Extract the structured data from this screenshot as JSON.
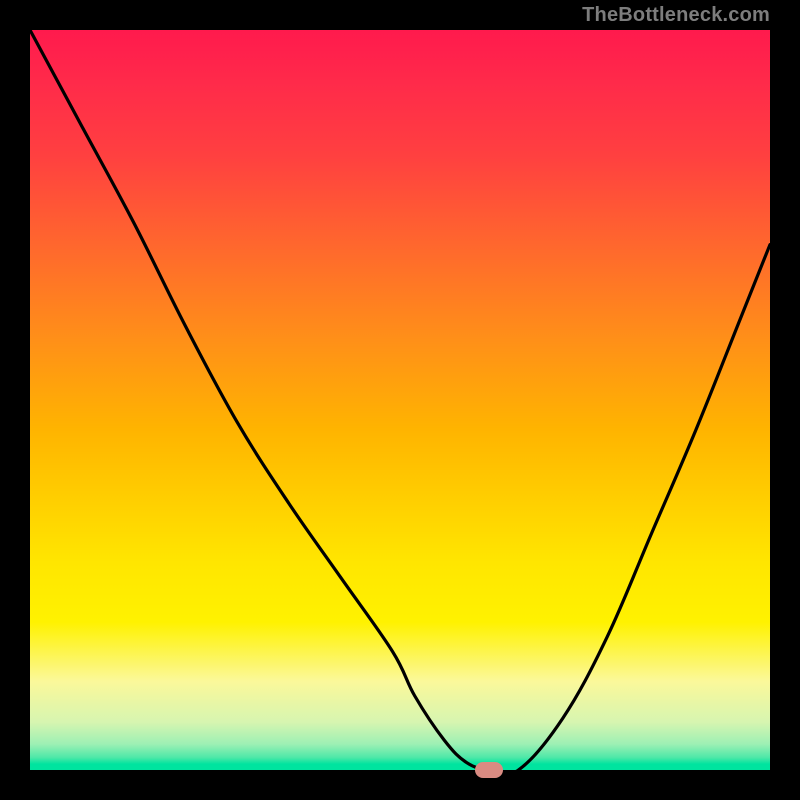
{
  "watermark": "TheBottleneck.com",
  "chart_data": {
    "type": "line",
    "title": "",
    "xlabel": "",
    "ylabel": "",
    "x_range": [
      0,
      100
    ],
    "y_range": [
      0,
      100
    ],
    "series": [
      {
        "name": "bottleneck-curve",
        "x": [
          0,
          7,
          14,
          21,
          28,
          35,
          42,
          49,
          52,
          56,
          59,
          62,
          66,
          72,
          78,
          84,
          90,
          96,
          100
        ],
        "y": [
          100,
          87,
          74,
          60,
          47,
          36,
          26,
          16,
          10,
          4,
          1,
          0,
          0,
          7,
          18,
          32,
          46,
          61,
          71
        ]
      }
    ],
    "optimum_marker": {
      "x": 62,
      "y": 0
    },
    "background_gradient": {
      "top": "#ff1a4d",
      "mid": "#ffe600",
      "bottom": "#00e49f"
    }
  }
}
